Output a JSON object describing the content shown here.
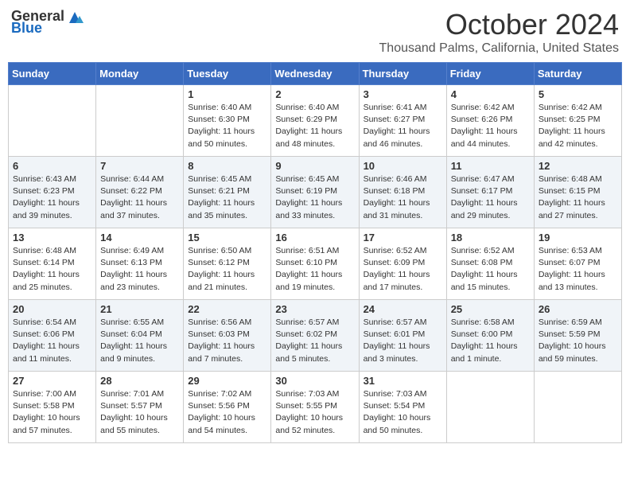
{
  "header": {
    "logo_general": "General",
    "logo_blue": "Blue",
    "month": "October 2024",
    "location": "Thousand Palms, California, United States"
  },
  "weekdays": [
    "Sunday",
    "Monday",
    "Tuesday",
    "Wednesday",
    "Thursday",
    "Friday",
    "Saturday"
  ],
  "weeks": [
    [
      {
        "day": "",
        "info": ""
      },
      {
        "day": "",
        "info": ""
      },
      {
        "day": "1",
        "info": "Sunrise: 6:40 AM\nSunset: 6:30 PM\nDaylight: 11 hours and 50 minutes."
      },
      {
        "day": "2",
        "info": "Sunrise: 6:40 AM\nSunset: 6:29 PM\nDaylight: 11 hours and 48 minutes."
      },
      {
        "day": "3",
        "info": "Sunrise: 6:41 AM\nSunset: 6:27 PM\nDaylight: 11 hours and 46 minutes."
      },
      {
        "day": "4",
        "info": "Sunrise: 6:42 AM\nSunset: 6:26 PM\nDaylight: 11 hours and 44 minutes."
      },
      {
        "day": "5",
        "info": "Sunrise: 6:42 AM\nSunset: 6:25 PM\nDaylight: 11 hours and 42 minutes."
      }
    ],
    [
      {
        "day": "6",
        "info": "Sunrise: 6:43 AM\nSunset: 6:23 PM\nDaylight: 11 hours and 39 minutes."
      },
      {
        "day": "7",
        "info": "Sunrise: 6:44 AM\nSunset: 6:22 PM\nDaylight: 11 hours and 37 minutes."
      },
      {
        "day": "8",
        "info": "Sunrise: 6:45 AM\nSunset: 6:21 PM\nDaylight: 11 hours and 35 minutes."
      },
      {
        "day": "9",
        "info": "Sunrise: 6:45 AM\nSunset: 6:19 PM\nDaylight: 11 hours and 33 minutes."
      },
      {
        "day": "10",
        "info": "Sunrise: 6:46 AM\nSunset: 6:18 PM\nDaylight: 11 hours and 31 minutes."
      },
      {
        "day": "11",
        "info": "Sunrise: 6:47 AM\nSunset: 6:17 PM\nDaylight: 11 hours and 29 minutes."
      },
      {
        "day": "12",
        "info": "Sunrise: 6:48 AM\nSunset: 6:15 PM\nDaylight: 11 hours and 27 minutes."
      }
    ],
    [
      {
        "day": "13",
        "info": "Sunrise: 6:48 AM\nSunset: 6:14 PM\nDaylight: 11 hours and 25 minutes."
      },
      {
        "day": "14",
        "info": "Sunrise: 6:49 AM\nSunset: 6:13 PM\nDaylight: 11 hours and 23 minutes."
      },
      {
        "day": "15",
        "info": "Sunrise: 6:50 AM\nSunset: 6:12 PM\nDaylight: 11 hours and 21 minutes."
      },
      {
        "day": "16",
        "info": "Sunrise: 6:51 AM\nSunset: 6:10 PM\nDaylight: 11 hours and 19 minutes."
      },
      {
        "day": "17",
        "info": "Sunrise: 6:52 AM\nSunset: 6:09 PM\nDaylight: 11 hours and 17 minutes."
      },
      {
        "day": "18",
        "info": "Sunrise: 6:52 AM\nSunset: 6:08 PM\nDaylight: 11 hours and 15 minutes."
      },
      {
        "day": "19",
        "info": "Sunrise: 6:53 AM\nSunset: 6:07 PM\nDaylight: 11 hours and 13 minutes."
      }
    ],
    [
      {
        "day": "20",
        "info": "Sunrise: 6:54 AM\nSunset: 6:06 PM\nDaylight: 11 hours and 11 minutes."
      },
      {
        "day": "21",
        "info": "Sunrise: 6:55 AM\nSunset: 6:04 PM\nDaylight: 11 hours and 9 minutes."
      },
      {
        "day": "22",
        "info": "Sunrise: 6:56 AM\nSunset: 6:03 PM\nDaylight: 11 hours and 7 minutes."
      },
      {
        "day": "23",
        "info": "Sunrise: 6:57 AM\nSunset: 6:02 PM\nDaylight: 11 hours and 5 minutes."
      },
      {
        "day": "24",
        "info": "Sunrise: 6:57 AM\nSunset: 6:01 PM\nDaylight: 11 hours and 3 minutes."
      },
      {
        "day": "25",
        "info": "Sunrise: 6:58 AM\nSunset: 6:00 PM\nDaylight: 11 hours and 1 minute."
      },
      {
        "day": "26",
        "info": "Sunrise: 6:59 AM\nSunset: 5:59 PM\nDaylight: 10 hours and 59 minutes."
      }
    ],
    [
      {
        "day": "27",
        "info": "Sunrise: 7:00 AM\nSunset: 5:58 PM\nDaylight: 10 hours and 57 minutes."
      },
      {
        "day": "28",
        "info": "Sunrise: 7:01 AM\nSunset: 5:57 PM\nDaylight: 10 hours and 55 minutes."
      },
      {
        "day": "29",
        "info": "Sunrise: 7:02 AM\nSunset: 5:56 PM\nDaylight: 10 hours and 54 minutes."
      },
      {
        "day": "30",
        "info": "Sunrise: 7:03 AM\nSunset: 5:55 PM\nDaylight: 10 hours and 52 minutes."
      },
      {
        "day": "31",
        "info": "Sunrise: 7:03 AM\nSunset: 5:54 PM\nDaylight: 10 hours and 50 minutes."
      },
      {
        "day": "",
        "info": ""
      },
      {
        "day": "",
        "info": ""
      }
    ]
  ]
}
